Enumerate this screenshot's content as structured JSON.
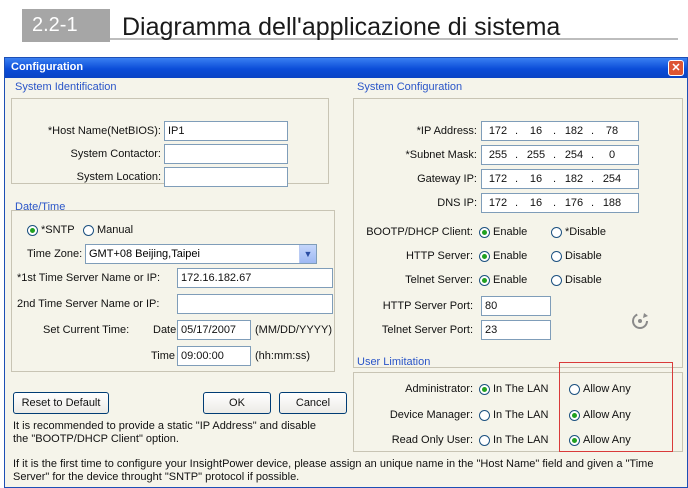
{
  "caption": {
    "badge": "2.2-1",
    "title": "Diagramma dell'applicazione di sistema"
  },
  "window": {
    "title": "Configuration",
    "close_glyph": "✕"
  },
  "system_identification": {
    "heading": "System Identification",
    "host_name_label": "*Host Name(NetBIOS):",
    "host_name_value": "IP1",
    "contactor_label": "System Contactor:",
    "contactor_value": "",
    "location_label": "System Location:",
    "location_value": ""
  },
  "date_time": {
    "heading": "Date/Time",
    "sntp_label": "*SNTP",
    "manual_label": "Manual",
    "timezone_label": "Time Zone:",
    "timezone_value": "GMT+08 Beijing,Taipei",
    "server1_label": "*1st Time Server Name or IP:",
    "server1_value": "172.16.182.67",
    "server2_label": "2nd Time Server Name or IP:",
    "server2_value": "",
    "set_time_label": "Set Current Time:",
    "date_label": "Date",
    "date_value": "05/17/2007",
    "date_format": "(MM/DD/YYYY)",
    "time_label": "Time",
    "time_value": "09:00:00",
    "time_format": "(hh:mm:ss)"
  },
  "buttons": {
    "reset": "Reset to Default",
    "ok": "OK",
    "cancel": "Cancel"
  },
  "notes": {
    "recommend": "It is recommended to provide a static \"IP Address\" and disable the \"BOOTP/DHCP Client\" option.",
    "footer": "If it is the first time to configure your InsightPower device, please assign an unique name in the \"Host Name\" field and given a \"Time Server\" for the device throught \"SNTP\" protocol if possible."
  },
  "system_configuration": {
    "heading": "System Configuration",
    "ip_label": "*IP Address:",
    "ip": [
      "172",
      "16",
      "182",
      "78"
    ],
    "mask_label": "*Subnet Mask:",
    "mask": [
      "255",
      "255",
      "254",
      "0"
    ],
    "gateway_label": "Gateway IP:",
    "gateway": [
      "172",
      "16",
      "182",
      "254"
    ],
    "dns_label": "DNS IP:",
    "dns": [
      "172",
      "16",
      "176",
      "188"
    ],
    "bootp_label": "BOOTP/DHCP Client:",
    "http_label": "HTTP Server:",
    "telnet_label": "Telnet Server:",
    "enable_label": "Enable",
    "disable_label": "Disable",
    "disable_star_label": "*Disable",
    "http_port_label": "HTTP Server Port:",
    "http_port": "80",
    "telnet_port_label": "Telnet Server Port:",
    "telnet_port": "23"
  },
  "user_limitation": {
    "heading": "User Limitation",
    "admin_label": "Administrator:",
    "device_label": "Device Manager:",
    "readonly_label": "Read Only User:",
    "lan_label": "In The LAN",
    "any_label": "Allow Any"
  },
  "colors": {
    "highlight_box": "#d93a3a",
    "titlebar": "#0b4dd8",
    "section_heading": "#2a55c8",
    "radio_selected": "#21a121"
  }
}
